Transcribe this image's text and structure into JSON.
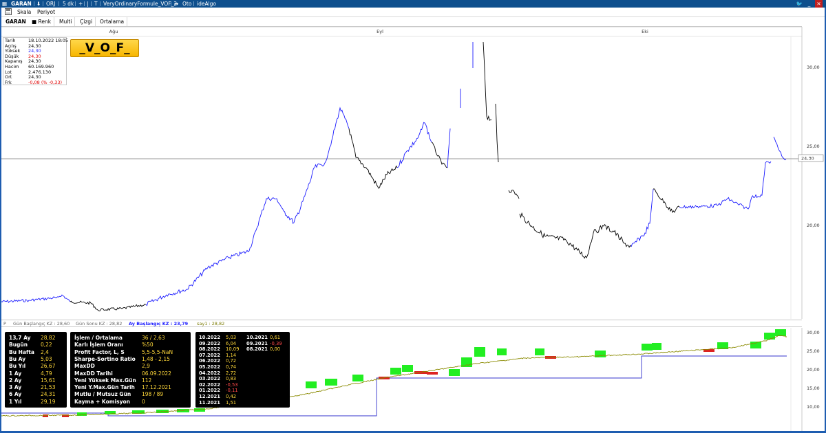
{
  "titlebar": {
    "symbol": "GARAN",
    "source": "ORJ",
    "period": "5 dk",
    "formula": "VeryOrdinaryFormule_VOF_2",
    "mode": "Oto",
    "broker": "ideAlgo"
  },
  "toolbar": {
    "menu_scale": "Skala",
    "menu_period": "Periyot"
  },
  "tabs": {
    "symbol": "GARAN",
    "color": "Renk",
    "multi": "Multi",
    "draw": "Çizgi",
    "average": "Ortalama"
  },
  "months": [
    "Ağu",
    "Eyl",
    "Eki"
  ],
  "info": [
    {
      "k": "Tarih",
      "v": "18.10.2022 18:05",
      "color": "#000000"
    },
    {
      "k": "Açılış",
      "v": "24,30",
      "color": "#000000"
    },
    {
      "k": "Yüksek",
      "v": "24,30",
      "color": "#1a1aff"
    },
    {
      "k": "Düşük",
      "v": "24,30",
      "color": "#e00000"
    },
    {
      "k": "Kapanış",
      "v": "24,30",
      "color": "#000000"
    },
    {
      "k": "Hacim",
      "v": "60.169.960",
      "color": "#000000"
    },
    {
      "k": "Lot",
      "v": "2.476.130",
      "color": "#000000"
    },
    {
      "k": "Ort",
      "v": "24,30",
      "color": "#000000"
    },
    {
      "k": "Frk",
      "v": "-0,08 (% -0,33)",
      "color": "#e00000"
    }
  ],
  "vof_label": "_V_O_F_",
  "price_axis": [
    "30,00",
    "25,00",
    "20,00"
  ],
  "last_price": "24,30",
  "status": {
    "p": "P",
    "day_start": "Gün Başlangıç KZ : 28,60",
    "day_end": "Gün Sonu KZ : 28,82",
    "month_start": "Ay Başlangıç KZ : 23,79",
    "counter": "say1 : 28,82"
  },
  "equity_axis": [
    "30,00",
    "25,00",
    "20,00",
    "15,00",
    "10,00"
  ],
  "panel1": [
    {
      "k": "13,7 Ay",
      "v": "28,82",
      "red": false
    },
    {
      "k": "Bugün",
      "v": "0,22",
      "red": false
    },
    {
      "k": "Bu Hafta",
      "v": "2,4",
      "red": false
    },
    {
      "k": "Bu Ay",
      "v": "5,03",
      "red": false
    },
    {
      "k": "Bu Yıl",
      "v": "26,67",
      "red": false
    },
    {
      "k": "1 Ay",
      "v": "4,79",
      "red": false
    },
    {
      "k": "2 Ay",
      "v": "15,61",
      "red": false
    },
    {
      "k": "3 Ay",
      "v": "21,53",
      "red": false
    },
    {
      "k": "6 Ay",
      "v": "24,31",
      "red": false
    },
    {
      "k": "1 Yıl",
      "v": "29,19",
      "red": false
    }
  ],
  "panel2": [
    {
      "k": "İşlem / Ortalama",
      "v": "36 / 2,63"
    },
    {
      "k": "Karlı İşlem Oranı",
      "v": "%50"
    },
    {
      "k": "Profit Factor, L, S",
      "v": "5,5-5,5-NaN"
    },
    {
      "k": "Sharpe-Sortino Ratio",
      "v": "1,48 - 2,15"
    },
    {
      "k": "MaxDD",
      "v": "2,9"
    },
    {
      "k": "MaxDD Tarihi",
      "v": "06.09.2022"
    },
    {
      "k": "Yeni Yüksek Max.Gün",
      "v": "112"
    },
    {
      "k": "Yeni Y.Max.Gün Tarih",
      "v": "17.12.2021"
    },
    {
      "k": "Mutlu / Mutsuz Gün",
      "v": "198 / 89"
    },
    {
      "k": "Kayma + Komisyon",
      "v": "0"
    }
  ],
  "panel3_left": [
    {
      "k": "10.2022",
      "v": "5,03",
      "red": false
    },
    {
      "k": "09.2022",
      "v": "6,04",
      "red": false
    },
    {
      "k": "08.2022",
      "v": "10,09",
      "red": false
    },
    {
      "k": "07.2022",
      "v": "1,14",
      "red": false
    },
    {
      "k": "06.2022",
      "v": "0,72",
      "red": false
    },
    {
      "k": "05.2022",
      "v": "0,74",
      "red": false
    },
    {
      "k": "04.2022",
      "v": "2,72",
      "red": false
    },
    {
      "k": "03.2022",
      "v": "0,83",
      "red": false
    },
    {
      "k": "02.2022",
      "v": "-0,53",
      "red": true
    },
    {
      "k": "01.2022",
      "v": "-0,11",
      "red": true
    },
    {
      "k": "12.2021",
      "v": "0,42",
      "red": false
    },
    {
      "k": "11.2021",
      "v": "1,51",
      "red": false
    }
  ],
  "panel3_right": [
    {
      "k": "10.2021",
      "v": "0,61",
      "red": false
    },
    {
      "k": "09.2021",
      "v": "-0,39",
      "red": true
    },
    {
      "k": "08.2021",
      "v": "0,00",
      "red": false
    }
  ],
  "colors": {
    "frame": "#1e5db0",
    "titlebar": "#0e4f8d",
    "long": "#1a1aff",
    "flat": "#000000",
    "up": "#22ee22",
    "down": "#dd2222"
  }
}
